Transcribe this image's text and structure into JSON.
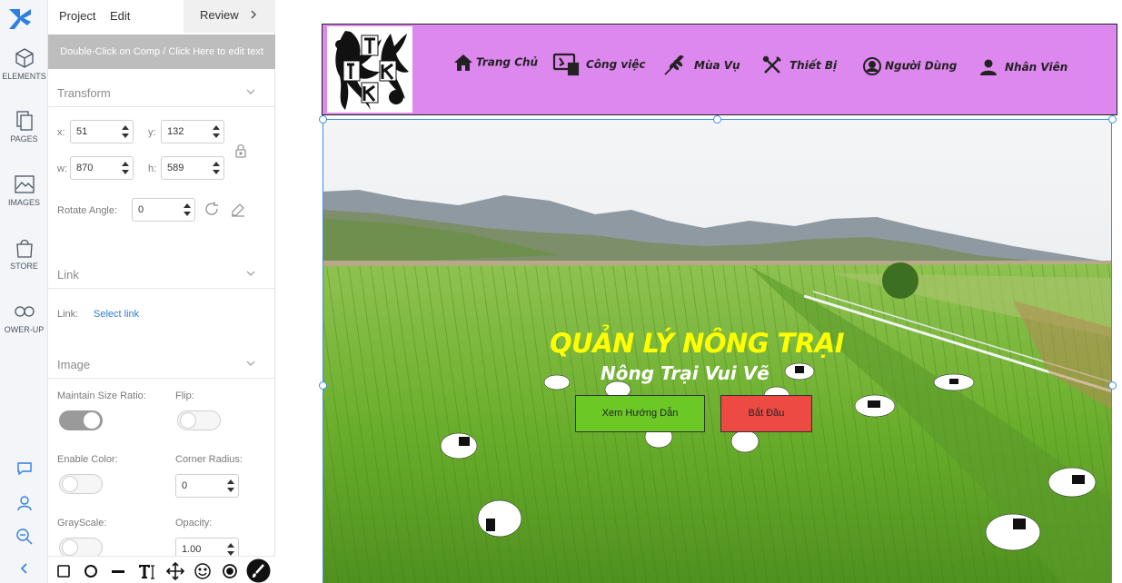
{
  "rail": {
    "items": [
      {
        "label": "ELEMENTS"
      },
      {
        "label": "PAGES"
      },
      {
        "label": "IMAGES"
      },
      {
        "label": "STORE"
      },
      {
        "label": "OWER-UP"
      }
    ]
  },
  "topbar": {
    "project": "Project",
    "edit": "Edit",
    "review": "Review"
  },
  "edit_hint": "Double-Click on Comp / Click Here to edit text",
  "transform": {
    "title": "Transform",
    "x_label": "x:",
    "x": "51",
    "y_label": "y:",
    "y": "132",
    "w_label": "w:",
    "w": "870",
    "h_label": "h:",
    "h": "589",
    "rotate_label": "Rotate Angle:",
    "rotate": "0"
  },
  "link": {
    "title": "Link",
    "label": "Link:",
    "value": "Select link"
  },
  "image": {
    "title": "Image",
    "maintain_ratio_label": "Maintain Size Ratio:",
    "maintain_ratio": true,
    "flip_label": "Flip:",
    "flip": false,
    "enable_color_label": "Enable Color:",
    "enable_color": false,
    "corner_radius_label": "Corner Radius:",
    "corner_radius": "0",
    "grayscale_label": "GrayScale:",
    "grayscale": false,
    "opacity_label": "Opacity:",
    "opacity": "1.00"
  },
  "site": {
    "nav": [
      {
        "label": "Trang Chủ",
        "icon": "home-icon"
      },
      {
        "label": "Công việc",
        "icon": "work-icon"
      },
      {
        "label": "Mùa Vụ",
        "icon": "wheat-icon"
      },
      {
        "label": "Thiết Bị",
        "icon": "tools-icon"
      },
      {
        "label": "Người Dùng",
        "icon": "user-circle-icon"
      },
      {
        "label": "Nhân Viên",
        "icon": "person-icon"
      }
    ],
    "hero_title": "QUẢN LÝ NÔNG TRẠI",
    "hero_subtitle": "Nông Trại Vui Vẽ",
    "btn_guide": "Xem Hướng Dẫn",
    "btn_start": "Bắt Đầu"
  },
  "colors": {
    "header_bg": "#dd88ee",
    "guide_btn": "#6cc925",
    "start_btn": "#ee4a44",
    "hero_title": "#ffff00",
    "selection": "#3d8fe0"
  }
}
